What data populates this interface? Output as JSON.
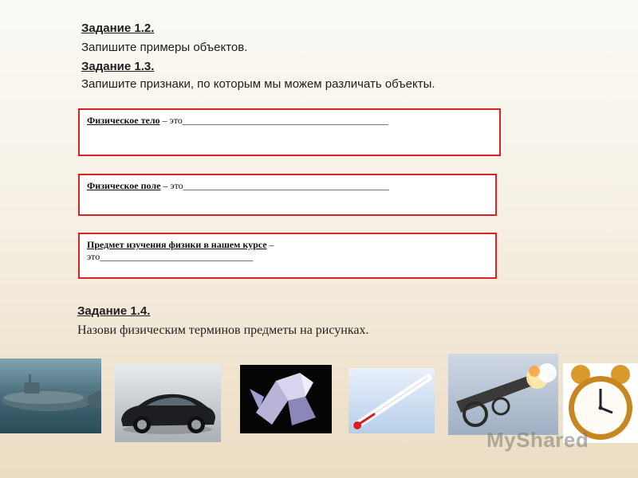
{
  "task12": {
    "heading": "Задание 1.2.",
    "text": "Запишите примеры объектов."
  },
  "task13": {
    "heading": "Задание 1.3.",
    "text": "Запишите признаки, по которым мы можем различать объекты."
  },
  "box1": {
    "term": "Физическое тело",
    "rest": " – это___________________________________________"
  },
  "box2": {
    "term": "Физическое поле",
    "rest": " – это___________________________________________"
  },
  "box3": {
    "term": "Предмет изучения физики в нашем курсе",
    "dash": " –",
    "line2": "это________________________________"
  },
  "task14": {
    "heading": "Задание 1.4.",
    "text": "Назови физическим терминов предметы на рисунках."
  },
  "images": [
    "submarine",
    "car",
    "crystal",
    "thermometer",
    "cannon",
    "alarm-clock"
  ],
  "watermark": "MyShared",
  "colors": {
    "box_border": "#d42424"
  }
}
